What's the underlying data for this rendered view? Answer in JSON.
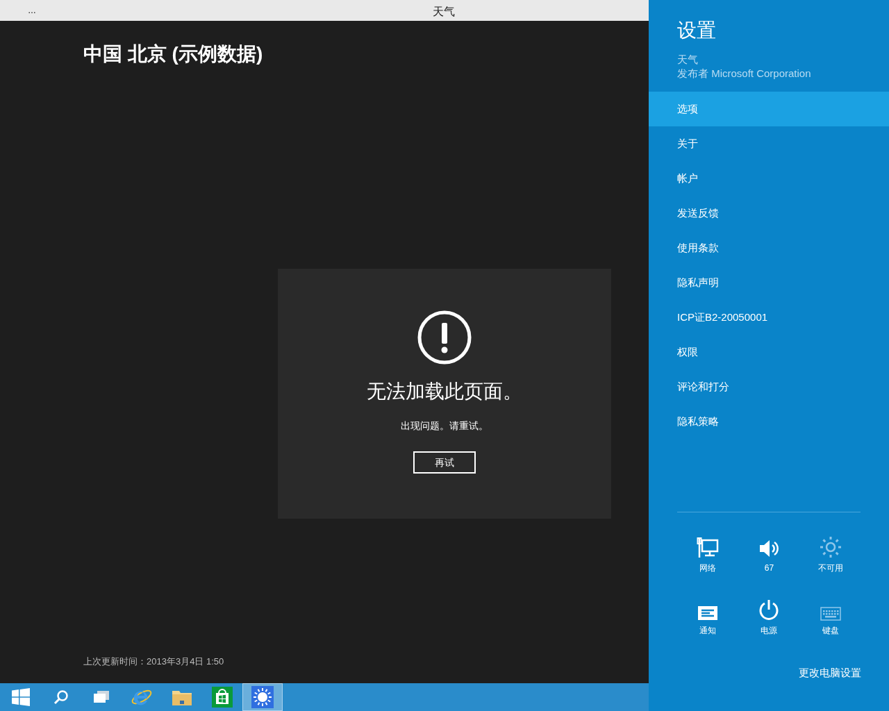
{
  "window": {
    "menu_glyph": "…",
    "title": "天气"
  },
  "page": {
    "location": "中国 北京 (示例数据)",
    "error": {
      "title": "无法加载此页面。",
      "message": "出现问题。请重试。",
      "retry_button": "再试"
    },
    "last_updated": "上次更新时间：2013年3月4日 1:50"
  },
  "taskbar": {
    "items": [
      {
        "kind": "start",
        "selected": false
      },
      {
        "kind": "search",
        "selected": false
      },
      {
        "kind": "taskview",
        "selected": false
      },
      {
        "kind": "browser",
        "selected": false
      },
      {
        "kind": "folder",
        "selected": false
      },
      {
        "kind": "store",
        "selected": false
      },
      {
        "kind": "weather",
        "selected": true
      }
    ]
  },
  "settings": {
    "title": "设置",
    "app_name": "天气",
    "publisher": "发布者 Microsoft Corporation",
    "items": [
      {
        "label": "选项",
        "selected": true
      },
      {
        "label": "关于",
        "selected": false
      },
      {
        "label": "帐户",
        "selected": false
      },
      {
        "label": "发送反馈",
        "selected": false
      },
      {
        "label": "使用条款",
        "selected": false
      },
      {
        "label": "隐私声明",
        "selected": false
      },
      {
        "label": "ICP证B2-20050001",
        "selected": false
      },
      {
        "label": "权限",
        "selected": false
      },
      {
        "label": "评论和打分",
        "selected": false
      },
      {
        "label": "隐私策略",
        "selected": false
      }
    ],
    "quick": [
      {
        "kind": "network",
        "label": "网络",
        "disabled": false
      },
      {
        "kind": "volume",
        "label": "67",
        "disabled": false
      },
      {
        "kind": "brightness",
        "label": "不可用",
        "disabled": true
      },
      {
        "kind": "notifications",
        "label": "通知",
        "disabled": false
      },
      {
        "kind": "power",
        "label": "电源",
        "disabled": false
      },
      {
        "kind": "keyboard",
        "label": "键盘",
        "disabled": true
      }
    ],
    "change_pc_settings": "更改电脑设置"
  }
}
